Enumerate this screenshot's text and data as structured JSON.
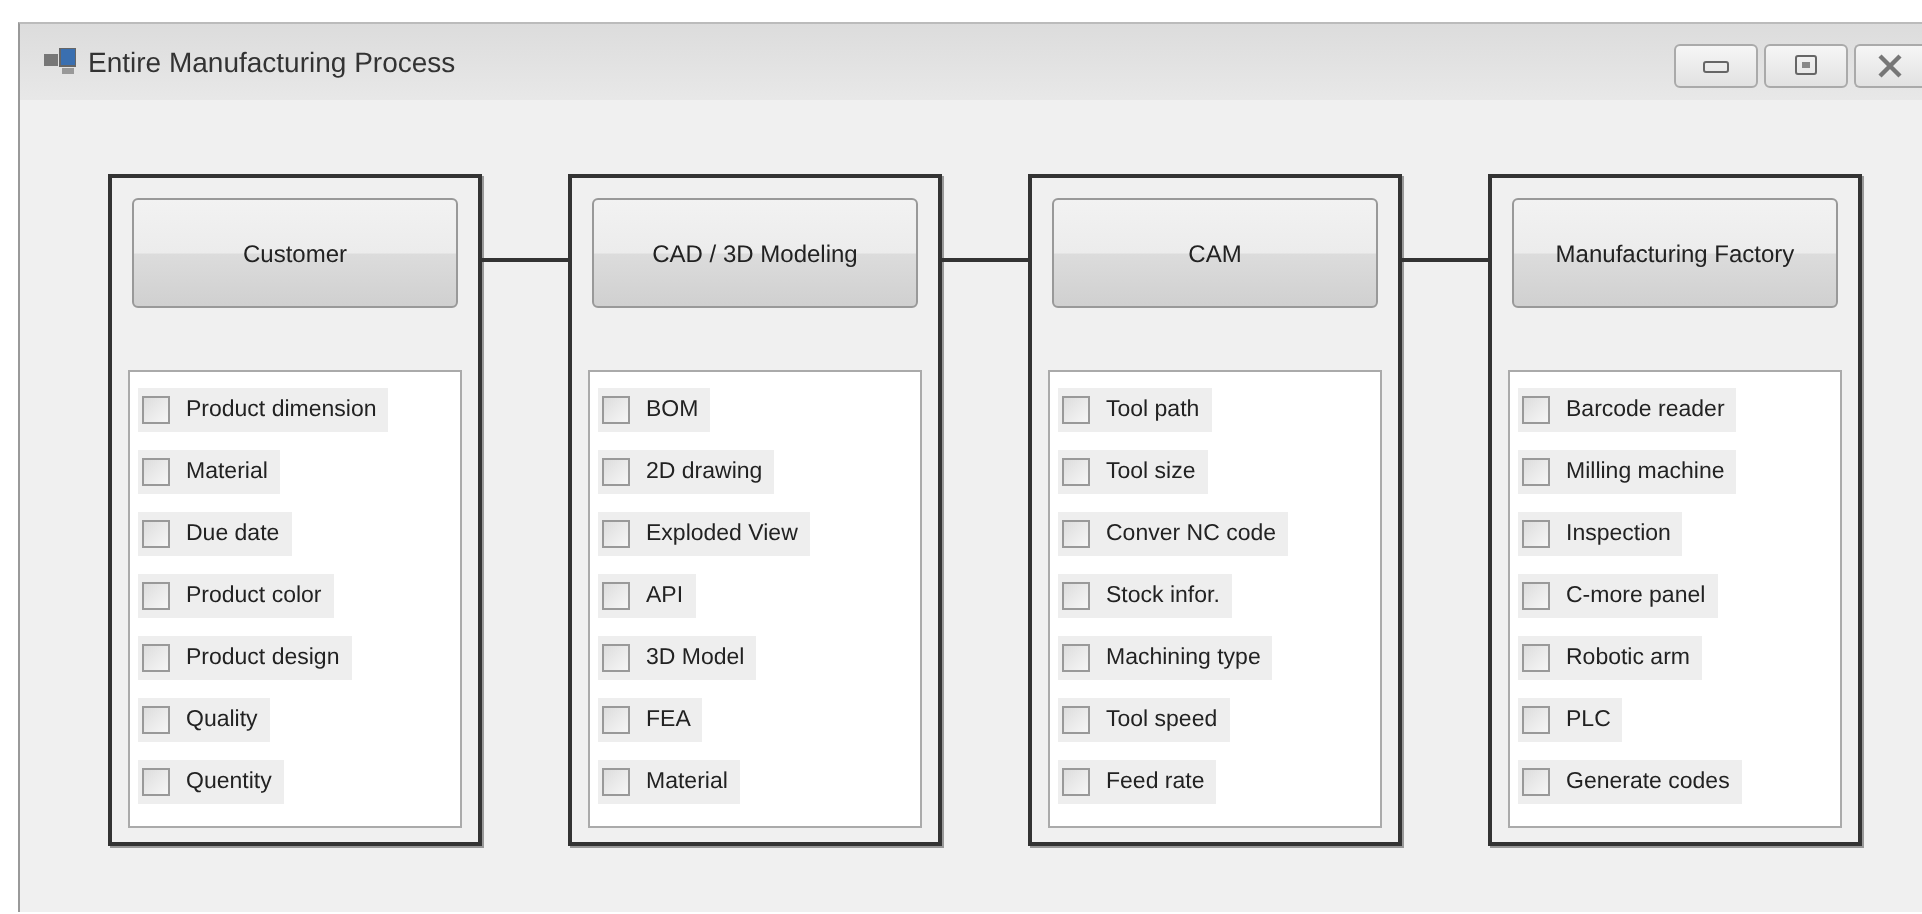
{
  "window": {
    "title": "Entire Manufacturing Process"
  },
  "panels": [
    {
      "button": "Customer",
      "items": [
        {
          "label": "Product dimension",
          "checked": false
        },
        {
          "label": "Material",
          "checked": false
        },
        {
          "label": "Due date",
          "checked": false
        },
        {
          "label": "Product color",
          "checked": false
        },
        {
          "label": "Product design",
          "checked": false
        },
        {
          "label": "Quality",
          "checked": false
        },
        {
          "label": "Quentity",
          "checked": false
        }
      ]
    },
    {
      "button": "CAD / 3D Modeling",
      "items": [
        {
          "label": "BOM",
          "checked": false
        },
        {
          "label": "2D drawing",
          "checked": false
        },
        {
          "label": "Exploded View",
          "checked": false
        },
        {
          "label": "API",
          "checked": false
        },
        {
          "label": "3D Model",
          "checked": false
        },
        {
          "label": "FEA",
          "checked": false
        },
        {
          "label": "Material",
          "checked": false
        }
      ]
    },
    {
      "button": "CAM",
      "items": [
        {
          "label": "Tool path",
          "checked": false
        },
        {
          "label": "Tool size",
          "checked": false
        },
        {
          "label": "Conver NC code",
          "checked": false
        },
        {
          "label": "Stock infor.",
          "checked": false
        },
        {
          "label": "Machining type",
          "checked": false
        },
        {
          "label": "Tool speed",
          "checked": false
        },
        {
          "label": "Feed rate",
          "checked": false
        }
      ]
    },
    {
      "button": "Manufacturing Factory",
      "items": [
        {
          "label": "Barcode reader",
          "checked": false
        },
        {
          "label": "Milling machine",
          "checked": false
        },
        {
          "label": "Inspection",
          "checked": false
        },
        {
          "label": "C-more panel",
          "checked": false
        },
        {
          "label": "Robotic arm",
          "checked": false
        },
        {
          "label": "PLC",
          "checked": false
        },
        {
          "label": "Generate codes",
          "checked": false
        }
      ]
    }
  ]
}
